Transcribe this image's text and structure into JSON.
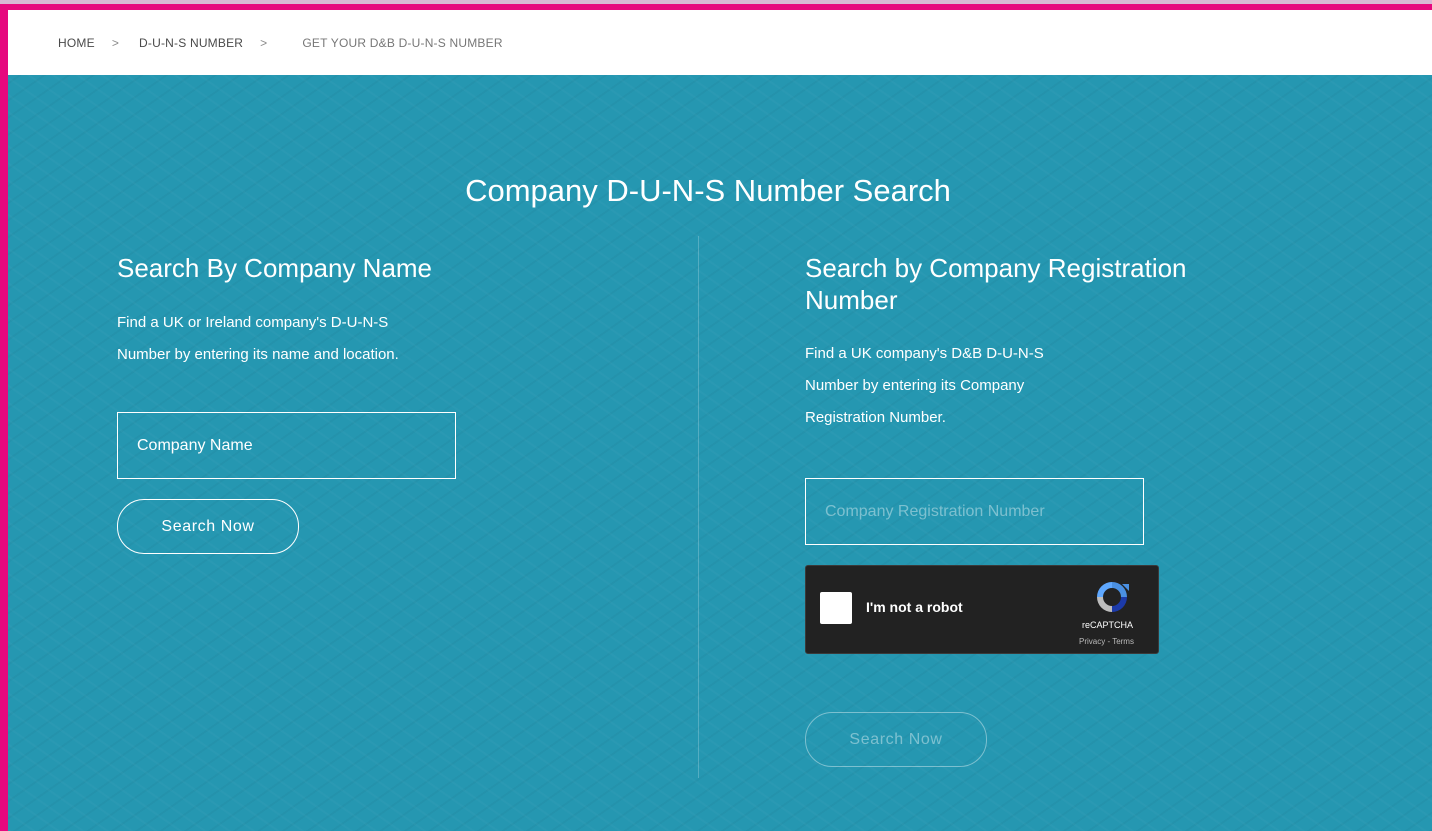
{
  "breadcrumb": {
    "home": "HOME",
    "separator": ">",
    "duns": "D-U-N-S NUMBER",
    "current": "GET YOUR D&B D-U-N-S NUMBER"
  },
  "page": {
    "title": "Company D-U-N-S Number Search"
  },
  "left": {
    "heading": "Search By Company Name",
    "line1": "Find a UK or Ireland company's D-U-N-S",
    "line2": "Number by entering its name and location.",
    "input_value": "Company Name",
    "button": "Search Now"
  },
  "right": {
    "heading_line1": "Search by Company Registration",
    "heading_line2": "Number",
    "line1": "Find a UK company's D&B D-U-N-S",
    "line2": "Number by entering its Company",
    "line3": "Registration Number.",
    "input_placeholder": "Company Registration Number",
    "button": "Search Now"
  },
  "captcha": {
    "label": "I'm not a robot",
    "brand": "reCAPTCHA",
    "links": "Privacy - Terms"
  },
  "colors": {
    "frame_border": "#e6087e",
    "panel_background": "#2597b1",
    "captcha_background": "#222222"
  },
  "icons": {
    "captcha_logo": "recaptcha-logo-icon"
  }
}
